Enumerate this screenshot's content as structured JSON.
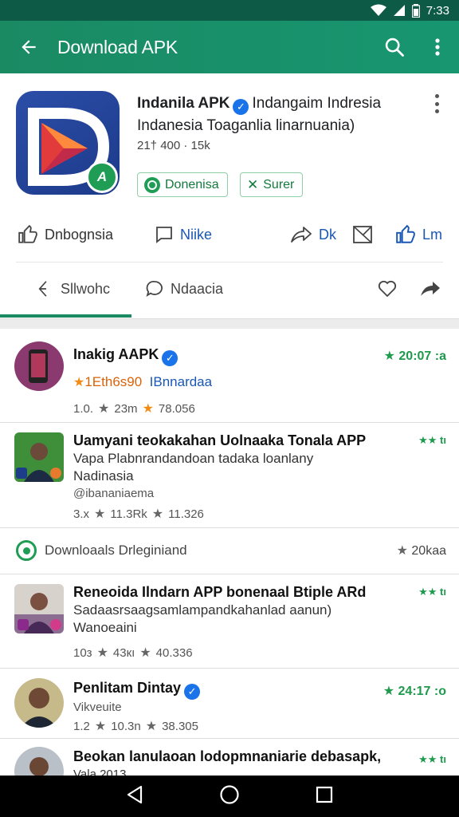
{
  "status_bar": {
    "time": "7:33"
  },
  "app_bar": {
    "title": "Download APK"
  },
  "featured": {
    "app_name": "Indanila APK",
    "title_rest": "Indangaim Indresia Indanesia Toaganlia linarnuania)",
    "downloads": "21† 400 · 15k",
    "chip_install": "Donenisa",
    "chip_surer": "Surer",
    "actions": {
      "like": "Dnbognsia",
      "comment": "Niike",
      "share": "Dk",
      "save": "",
      "thumbs": "Lm"
    },
    "tabs": {
      "first": "Sllwohc",
      "second": "Ndaacia"
    }
  },
  "list": {
    "rows": [
      {
        "title": "Inakig AAPK",
        "subtitle": "1Eth6s90",
        "subtitle_extra": "IBnnardaa",
        "meta1": "1.0.",
        "meta2": "23m",
        "meta3": "78.056",
        "rating": "20:07 :a"
      },
      {
        "title": "Uamyani teokakahan Uolnaaka Tonala APP",
        "subtitle": "Vapa Plabnrandandoan tadaka loanlany",
        "subtitle2": "Nadinasia",
        "subtitle3": "@ibananiaema",
        "meta1": "3.x",
        "meta2": "11.3Rk",
        "meta3": "11.326",
        "rating": "★★ tı"
      },
      {
        "section_label": "Downloaals Drleginiand",
        "rating": "20kaa"
      },
      {
        "title": "Reneoida Ilndarn APP bonenaal Btiple ARd",
        "subtitle": "Sadaasrsaagsamlampandkahanlad aanun)",
        "subtitle2": "Wanoeaini",
        "meta1": "10з",
        "meta2": "43кı",
        "meta3": "40.336",
        "rating": "★★ tı"
      },
      {
        "title": "Penlitam Dintay",
        "subtitle": "Vikveuite",
        "meta1": "1.2",
        "meta2": "10.3n",
        "meta3": "38.305",
        "rating": "24:17 :o"
      },
      {
        "title": "Beokan lanulaoan lodopmnaniarie debasapk,",
        "subtitle": "Vala 2013",
        "rating": "★★ tı"
      }
    ]
  },
  "colors": {
    "brand": "#1a8a63",
    "accent_blue": "#1a57b5",
    "rating_green": "#1d9a4c"
  }
}
